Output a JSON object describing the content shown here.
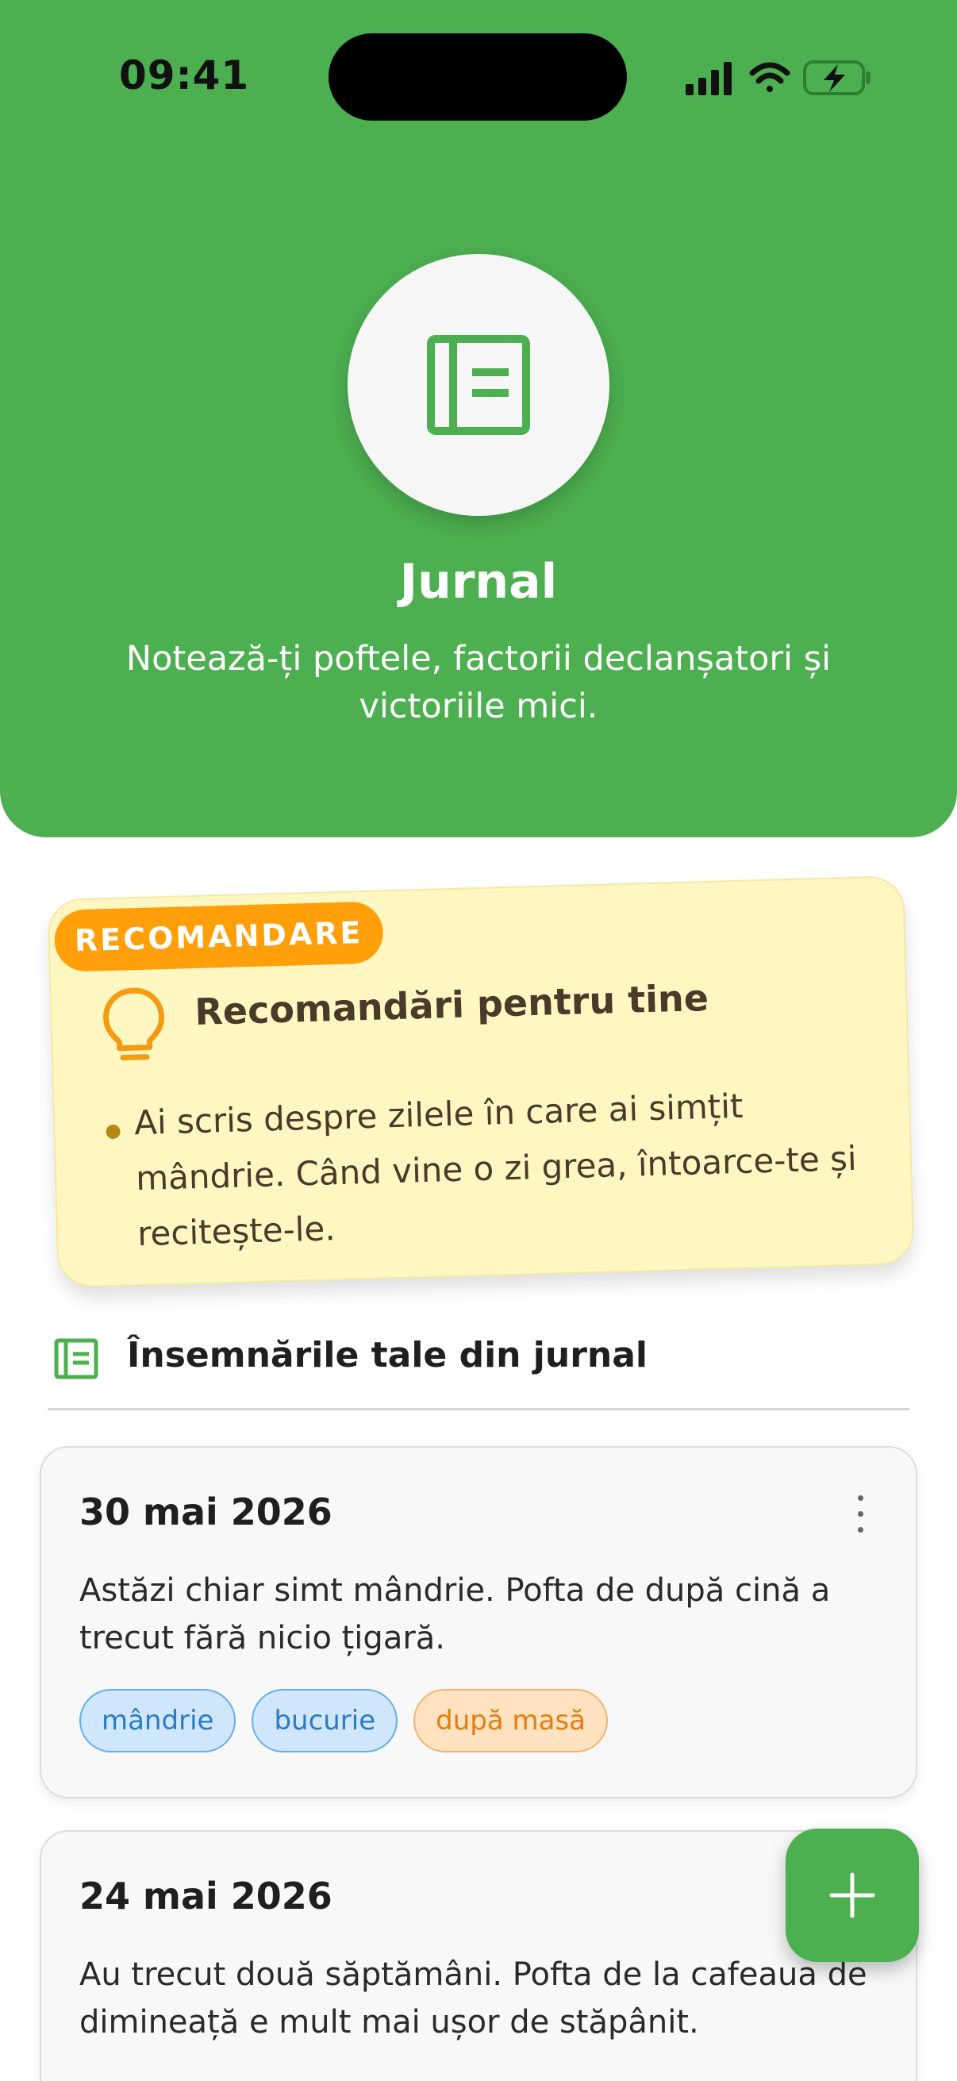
{
  "status_bar": {
    "time": "09:41",
    "icons": [
      "signal-icon",
      "wifi-icon",
      "battery-charging-icon"
    ]
  },
  "header": {
    "icon": "journal-icon",
    "title": "Jurnal",
    "subtitle": "Notează-ți poftele, factorii declanșatori și victoriile mici."
  },
  "recommendation": {
    "badge": "RECOMANDARE",
    "icon": "lightbulb-icon",
    "title": "Recomandări pentru tine",
    "items": [
      "Ai scris despre zilele în care ai simțit mândrie. Când vine o zi grea, întoarce-te și recitește-le."
    ]
  },
  "section": {
    "icon": "journal-icon",
    "title": "Însemnările tale din jurnal"
  },
  "entries": [
    {
      "date": "30 mai 2026",
      "text": "Astăzi chiar simt mândrie. Pofta de după cină a trecut fără nicio țigară.",
      "tags": [
        {
          "label": "mândrie",
          "color": "blue"
        },
        {
          "label": "bucurie",
          "color": "blue"
        },
        {
          "label": "după masă",
          "color": "orange"
        }
      ]
    },
    {
      "date": "24 mai 2026",
      "text": "Au trecut două săptămâni. Pofta de la cafeaua de dimineață e mult mai ușor de stăpânit."
    }
  ],
  "fab": {
    "icon": "plus-icon"
  },
  "colors": {
    "primary": "#4caf50",
    "accent": "#ff9f0a",
    "note_bg": "#fff7c2",
    "tag_blue": "#2a7bc8",
    "tag_orange": "#e37d10"
  }
}
